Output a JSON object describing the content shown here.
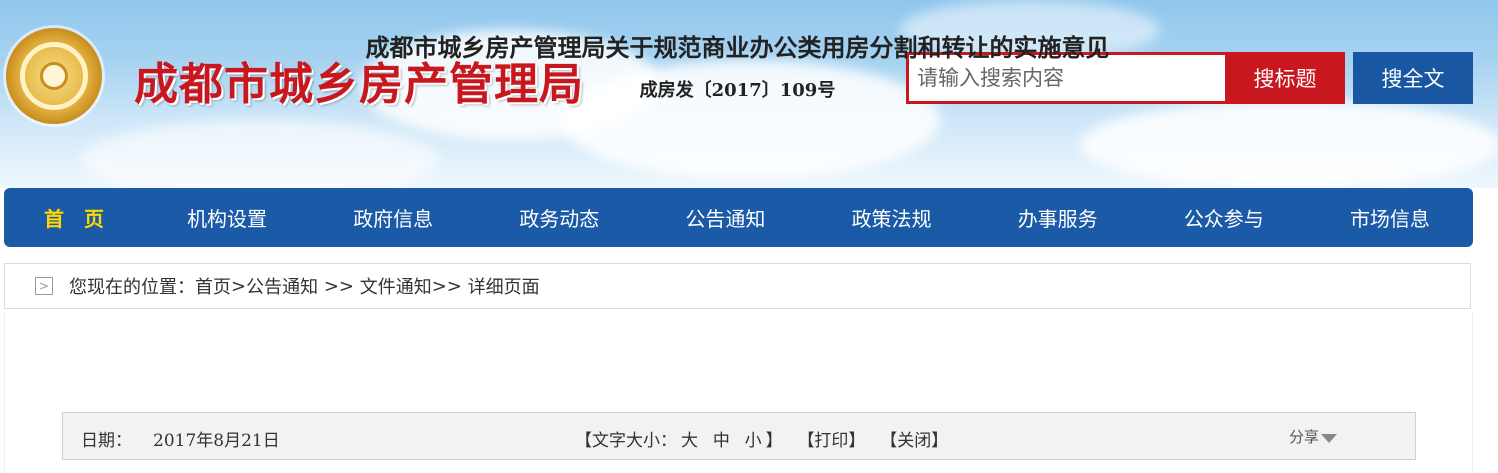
{
  "header": {
    "site_title": "成都市城乡房产管理局"
  },
  "search": {
    "placeholder": "请输入搜索内容",
    "title_button": "搜标题",
    "fulltext_button": "搜全文"
  },
  "nav": {
    "items": [
      {
        "label": "首　页"
      },
      {
        "label": "机构设置"
      },
      {
        "label": "政府信息"
      },
      {
        "label": "政务动态"
      },
      {
        "label": "公告通知"
      },
      {
        "label": "政策法规"
      },
      {
        "label": "办事服务"
      },
      {
        "label": "公众参与"
      },
      {
        "label": "市场信息"
      }
    ]
  },
  "breadcrumb": {
    "prefix": "您现在的位置：",
    "home": "首页",
    "sep1": " >",
    "level1": "公告通知",
    "sep2": " >> ",
    "level2": "文件通知",
    "sep3": ">> ",
    "current": "详细页面"
  },
  "article": {
    "title": "成都市城乡房产管理局关于规范商业办公类用房分割和转让的实施意见",
    "doc_number": "成房发〔2017〕109号",
    "date_label": "日期：",
    "date": "2017年8月21日",
    "font_size_label": "【文字大小：",
    "size_large": "大",
    "size_medium": "中",
    "size_small": "小",
    "font_size_close": "】",
    "print": "【打印】",
    "close": "【关闭】",
    "share": "分享"
  },
  "colors": {
    "brand_red": "#c8171e",
    "nav_blue": "#1a5aa6",
    "home_yellow": "#ffd800"
  }
}
